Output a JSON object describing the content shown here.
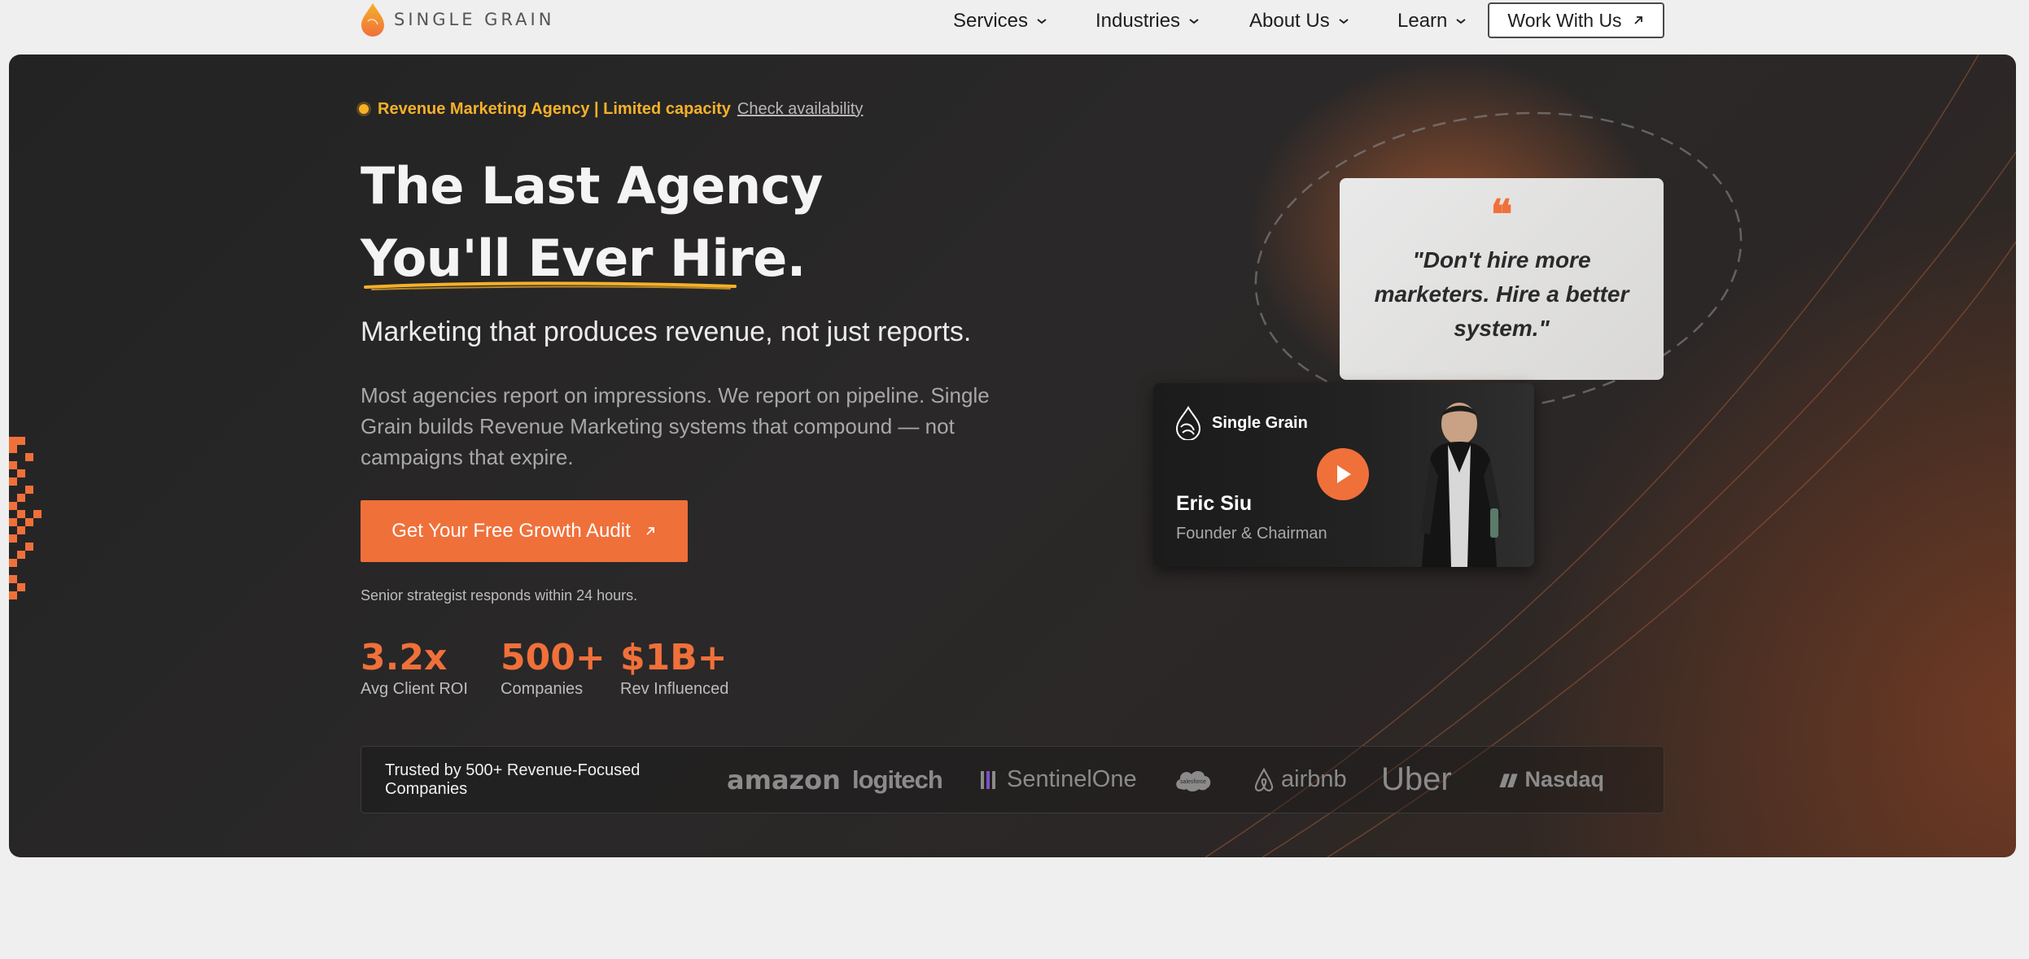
{
  "brand": {
    "name": "SINGLE GRAIN",
    "accent": "#f0703a",
    "badge_color": "#f6b129"
  },
  "nav": {
    "items": [
      {
        "label": "Services"
      },
      {
        "label": "Industries"
      },
      {
        "label": "About Us"
      },
      {
        "label": "Learn"
      }
    ],
    "cta_label": "Work With Us",
    "cta_icon": "arrow-up-right-icon"
  },
  "hero": {
    "badge_text": "Revenue Marketing Agency | Limited capacity",
    "badge_link": "Check availability",
    "headline_line1": "The Last Agency",
    "headline_line2": "You'll Ever Hire.",
    "subhead": "Marketing that produces revenue, not just reports.",
    "body": "Most agencies report on impressions. We report on pipeline. Single Grain builds Revenue Marketing systems that compound — not campaigns that expire.",
    "cta_label": "Get Your Free Growth Audit",
    "cta_note": "Senior strategist responds within 24 hours.",
    "stats": [
      {
        "value": "3.2x",
        "label": "Avg Client ROI"
      },
      {
        "value": "500+",
        "label": "Companies"
      },
      {
        "value": "$1B+",
        "label": "Rev Influenced"
      }
    ]
  },
  "quote": {
    "mark": "❝",
    "text": "\"Don't hire more marketers. Hire a better system.\""
  },
  "video": {
    "brand": "Single Grain",
    "name": "Eric Siu",
    "role": "Founder & Chairman"
  },
  "trusted": {
    "label": "Trusted by 500+ Revenue-Focused Companies",
    "logos": [
      "amazon",
      "logitech",
      "SentinelOne",
      "salesforce",
      "airbnb",
      "Uber",
      "Nasdaq"
    ]
  },
  "below": {
    "heading": ""
  }
}
